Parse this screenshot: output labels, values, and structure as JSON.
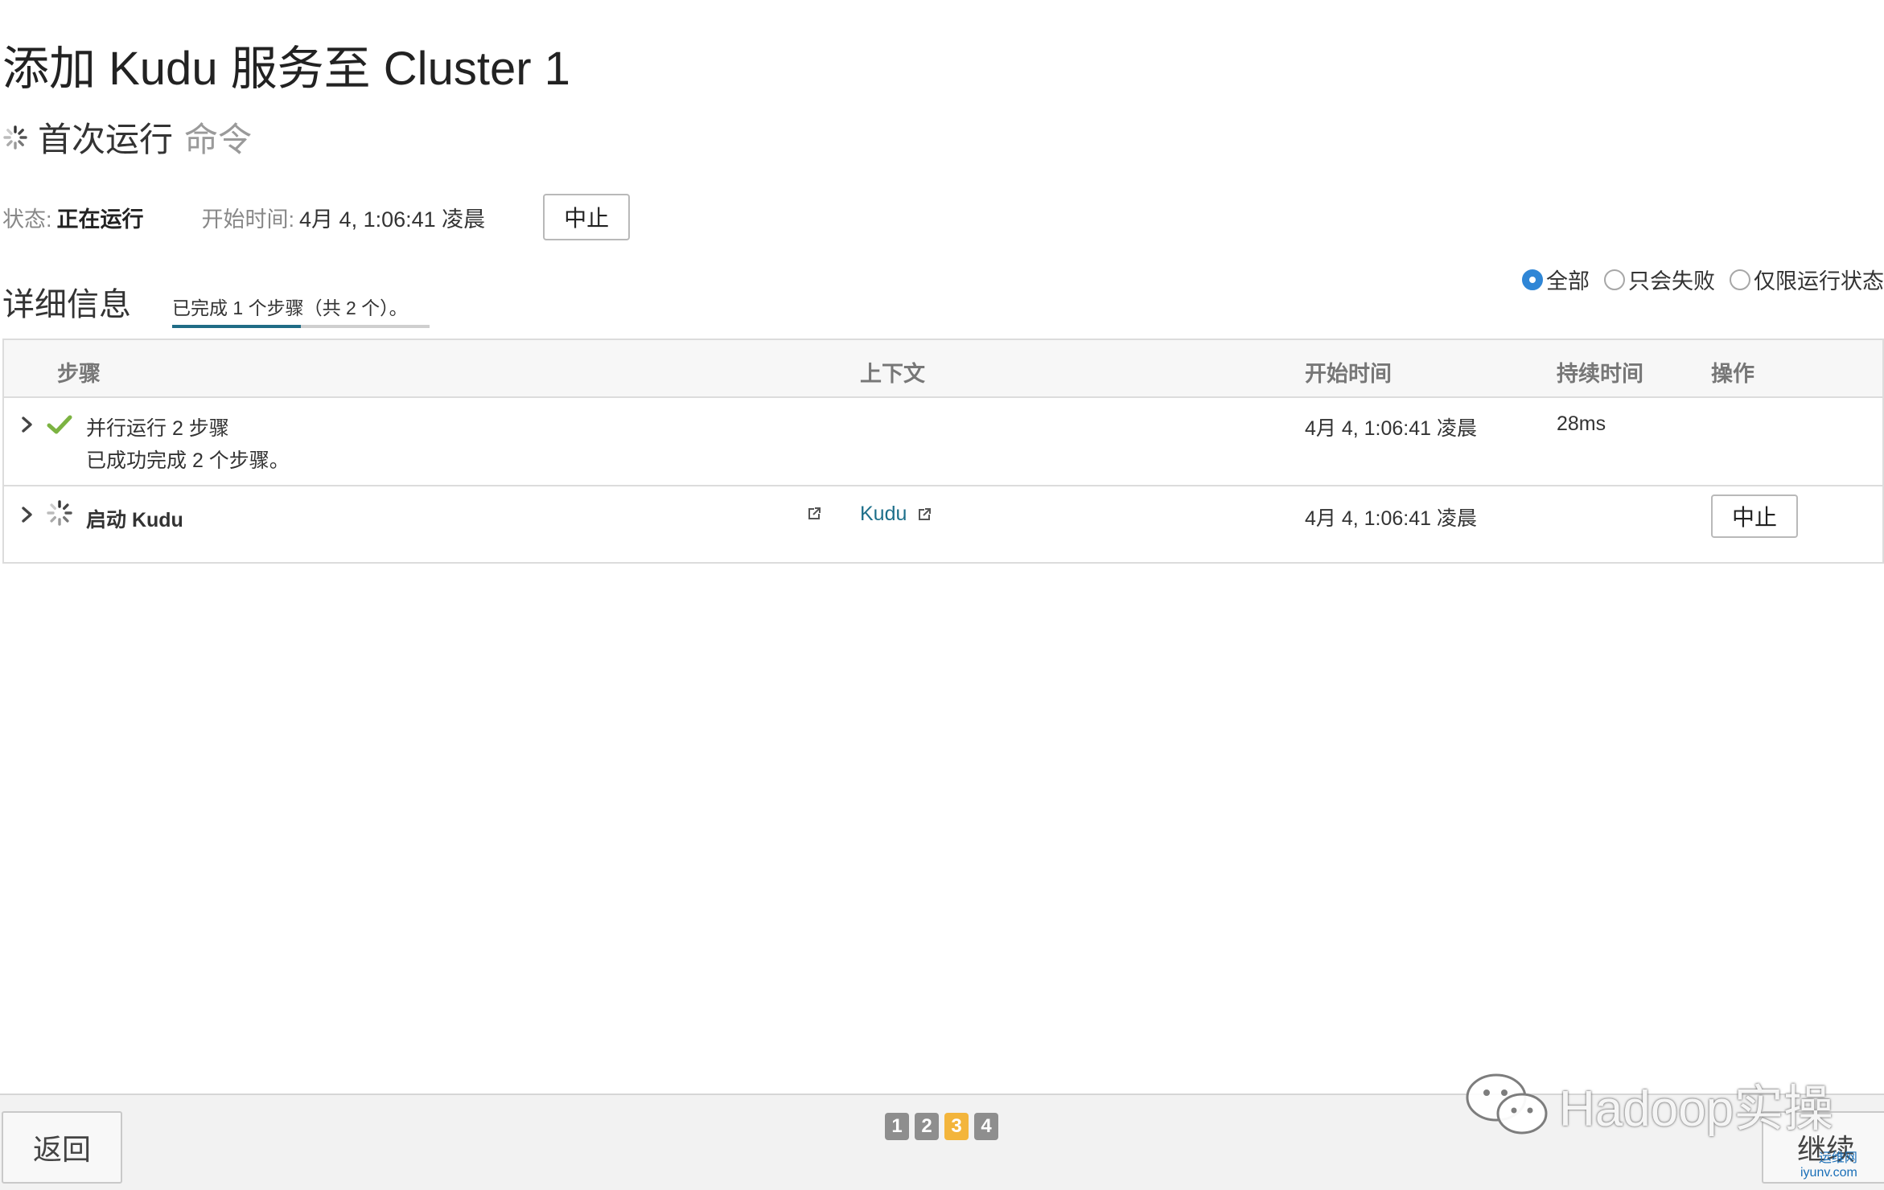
{
  "header": {
    "title": "添加 Kudu 服务至 Cluster 1",
    "command_name": "首次运行",
    "command_suffix": "命令"
  },
  "status": {
    "status_label": "状态:",
    "status_value": "正在运行",
    "start_label": "开始时间:",
    "start_value": "4月 4, 1:06:41 凌晨",
    "abort_label": "中止"
  },
  "details": {
    "title": "详细信息",
    "progress_text": "已完成 1 个步骤（共 2 个）。",
    "progress_fraction": 0.5,
    "filters": [
      {
        "label": "全部",
        "checked": true
      },
      {
        "label": "只会失败",
        "checked": false
      },
      {
        "label": "仅限运行状态",
        "checked": false
      }
    ]
  },
  "table": {
    "columns": {
      "step": "步骤",
      "context": "上下文",
      "start_time": "开始时间",
      "duration": "持续时间",
      "action": "操作"
    },
    "rows": [
      {
        "status": "success",
        "title": "并行运行 2 步骤",
        "subtitle": "已成功完成 2 个步骤。",
        "context": "",
        "start_time": "4月 4, 1:06:41 凌晨",
        "duration": "28ms",
        "action": ""
      },
      {
        "status": "running",
        "title": "启动 Kudu",
        "subtitle": "",
        "context": "Kudu",
        "start_time": "4月 4, 1:06:41 凌晨",
        "duration": "",
        "action": "中止"
      }
    ]
  },
  "footer": {
    "back_label": "返回",
    "continue_label": "继续",
    "pages": [
      "1",
      "2",
      "3",
      "4"
    ],
    "current_page": "3"
  },
  "watermark": {
    "text": "Hadoop实操",
    "site_line1": "运维网",
    "site_line2": "iyunv.com"
  },
  "colors": {
    "accent_link": "#1d6f8a",
    "success": "#7cb342",
    "active_page": "#f3b53c",
    "radio_checked": "#2f86d6"
  }
}
